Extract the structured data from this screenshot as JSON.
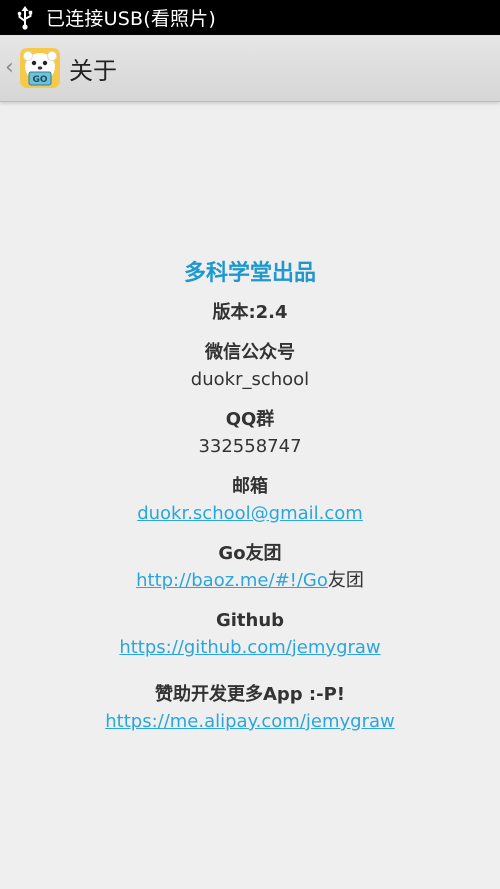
{
  "status_bar": {
    "icon": "usb-icon",
    "text": "已连接USB(看照片)"
  },
  "action_bar": {
    "back_icon": "chevron-left-icon",
    "app_icon": "app-logo-icon",
    "title": "关于"
  },
  "about": {
    "brand": "多科学堂出品",
    "version": "版本:2.4",
    "wechat": {
      "heading": "微信公众号",
      "value": "duokr_school"
    },
    "qq": {
      "heading": "QQ群",
      "value": "332558747"
    },
    "email": {
      "heading": "邮箱",
      "link": "duokr.school@gmail.com"
    },
    "go_group": {
      "heading": "Go友团",
      "link": "http://baoz.me/#!/Go",
      "suffix": "友团"
    },
    "github": {
      "heading": "Github",
      "link": "https://github.com/jemygraw"
    },
    "donate": {
      "heading": "赞助开发更多App :-P!",
      "link": "https://me.alipay.com/jemygraw"
    }
  },
  "colors": {
    "brand": "#1e98cf",
    "link": "#2aa6dc",
    "background": "#efefef"
  }
}
